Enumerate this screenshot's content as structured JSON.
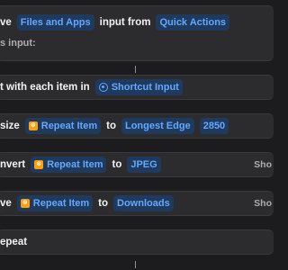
{
  "actions": [
    {
      "id": "receive",
      "prefix": "ve",
      "type_token": "Files and Apps",
      "mid": "input from",
      "source_token": "Quick Actions",
      "subtext": "s input:"
    },
    {
      "id": "repeat-each",
      "prefix": "t with each item in",
      "token": "Shortcut Input"
    },
    {
      "id": "resize",
      "prefix": "size",
      "token": "Repeat Item",
      "mid": "to",
      "edge_token": "Longest Edge",
      "size_token": "2850"
    },
    {
      "id": "convert",
      "prefix": "nvert",
      "token": "Repeat Item",
      "mid": "to",
      "format_token": "JPEG",
      "show": "Sho"
    },
    {
      "id": "save",
      "prefix": "ve",
      "token": "Repeat Item",
      "mid": "to",
      "dest_token": "Downloads",
      "show": "Sho"
    },
    {
      "id": "end-repeat",
      "label": "epeat"
    }
  ],
  "colors": {
    "background": "#1c1c1e",
    "card": "#2c2c2e",
    "token_text": "#64a8ff",
    "token_bg": "#1f3a5c",
    "variable_badge": "#ff9f0a"
  },
  "icons": {
    "repeat_item_badge": "variable-badge-icon",
    "shortcut_input": "gear-icon"
  }
}
